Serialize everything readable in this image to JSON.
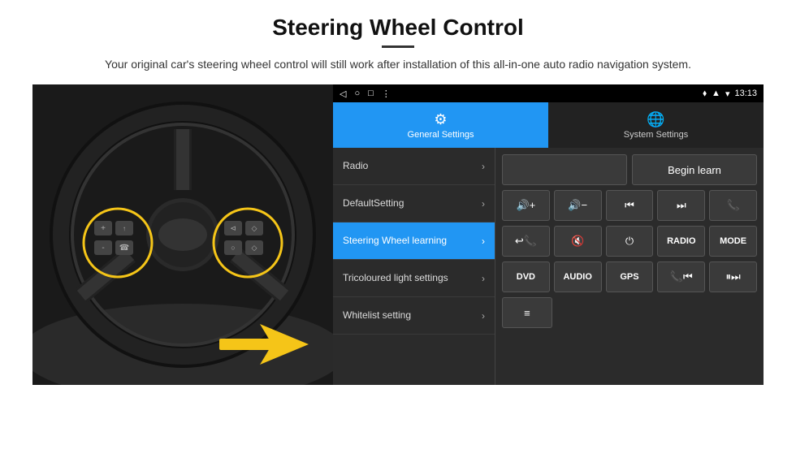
{
  "header": {
    "title": "Steering Wheel Control",
    "subtitle": "Your original car's steering wheel control will still work after installation of this all-in-one auto radio navigation system."
  },
  "statusbar": {
    "nav_back": "◁",
    "nav_home": "○",
    "nav_square": "□",
    "nav_menu": "⋮",
    "location_icon": "♦",
    "signal_icon": "▲",
    "time": "13:13"
  },
  "tabs": [
    {
      "id": "general",
      "icon": "⚙",
      "label": "General Settings",
      "active": true
    },
    {
      "id": "system",
      "icon": "🌐",
      "label": "System Settings",
      "active": false
    }
  ],
  "menu_items": [
    {
      "id": "radio",
      "label": "Radio",
      "active": false
    },
    {
      "id": "default",
      "label": "DefaultSetting",
      "active": false
    },
    {
      "id": "swl",
      "label": "Steering Wheel learning",
      "active": true
    },
    {
      "id": "tricolour",
      "label": "Tricoloured light settings",
      "active": false
    },
    {
      "id": "whitelist",
      "label": "Whitelist setting",
      "active": false
    }
  ],
  "controls": {
    "begin_learn_label": "Begin learn",
    "row2": [
      {
        "symbol": "🔊+",
        "label": "vol+"
      },
      {
        "symbol": "🔊-",
        "label": "vol-"
      },
      {
        "symbol": "⏮",
        "label": "prev"
      },
      {
        "symbol": "⏭",
        "label": "next"
      },
      {
        "symbol": "📞",
        "label": "call"
      }
    ],
    "row3": [
      {
        "symbol": "📞↩",
        "label": "hang"
      },
      {
        "symbol": "🔇",
        "label": "mute"
      },
      {
        "symbol": "⏻",
        "label": "power"
      },
      {
        "symbol": "RADIO",
        "label": "radio"
      },
      {
        "symbol": "MODE",
        "label": "mode"
      }
    ],
    "row4": [
      {
        "symbol": "DVD",
        "label": "dvd"
      },
      {
        "symbol": "AUDIO",
        "label": "audio"
      },
      {
        "symbol": "GPS",
        "label": "gps"
      },
      {
        "symbol": "📞⏮",
        "label": "tel-prev"
      },
      {
        "symbol": "⏸⏭",
        "label": "pause-next"
      }
    ],
    "row5": [
      {
        "symbol": "📋",
        "label": "list"
      }
    ]
  }
}
